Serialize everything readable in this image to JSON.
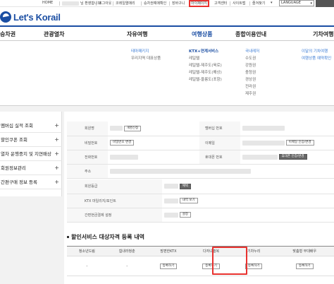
{
  "topbar": {
    "home": "HOME",
    "welcome_suffix": "님 환영합니다.",
    "logout": "로그아웃",
    "reservation_confirm": "코레일열매리",
    "ticket_check": "승차권예매확인",
    "cart": "장바구니",
    "mypage": "마이페이지",
    "customer_center": "고객센터",
    "sitemap": "사이트맵",
    "favorites": "즐겨찾기",
    "language": "LANGUAGE"
  },
  "logo": {
    "text": "Let's Korail"
  },
  "nav": [
    "승차권",
    "관광열차",
    "자유여행",
    "여행상품",
    "종합이용안내",
    "기차여행"
  ],
  "mega": {
    "col1": [
      "테마패키지",
      "우리지역 대표상품"
    ],
    "col2": [
      "KTX+연계서비스",
      "레일텔",
      "레일텔-제주도(육로)",
      "레일텔-제주도(해상)",
      "레일텔-울릉도(포항)"
    ],
    "col3": [
      "국내레저",
      "수도권",
      "강원권",
      "충청권",
      "경상권",
      "전라권",
      "제주권"
    ],
    "col4": [
      "이달의 기차여행",
      "",
      "여행상품 예약확인"
    ]
  },
  "left_menu": [
    "멤버십 실적 조회",
    "할인쿠폰 조회",
    "열차 운행중지 및 지연배상",
    "회원정보관리",
    "간편구매 정보 등록"
  ],
  "info_rows": {
    "member_name": "회원명",
    "member_no": "멤버십 번호",
    "password": "비밀번호",
    "email": "이메일",
    "phone": "전화번호",
    "mobile": "휴대폰 번호",
    "address": "주소",
    "grade": "회원등급",
    "ktx_mileage": "KTX 마일리지/포인트",
    "easy_pay": "간편현금결제 설정"
  },
  "buttons": {
    "change_member_type": "개명신청",
    "change_password": "비밀번호 변경",
    "email_verify": "이메일 인증/변경",
    "phone_verify": "휴대폰 인증/변경",
    "grade_benefit": "혜택",
    "mileage_detail": "내역 보기",
    "easypay_setting": "설정"
  },
  "section": {
    "title": "할인서비스 대상자격 등록 내역"
  },
  "reg_table": {
    "headers": [
      "청소년드림",
      "힘내라청춘",
      "맘편한KTX",
      "다자녀행복",
      "기차누리",
      "맞춤형 무대배우"
    ],
    "values": [
      "-",
      "-",
      "",
      "",
      "",
      ""
    ],
    "register_label": "등록하기"
  }
}
